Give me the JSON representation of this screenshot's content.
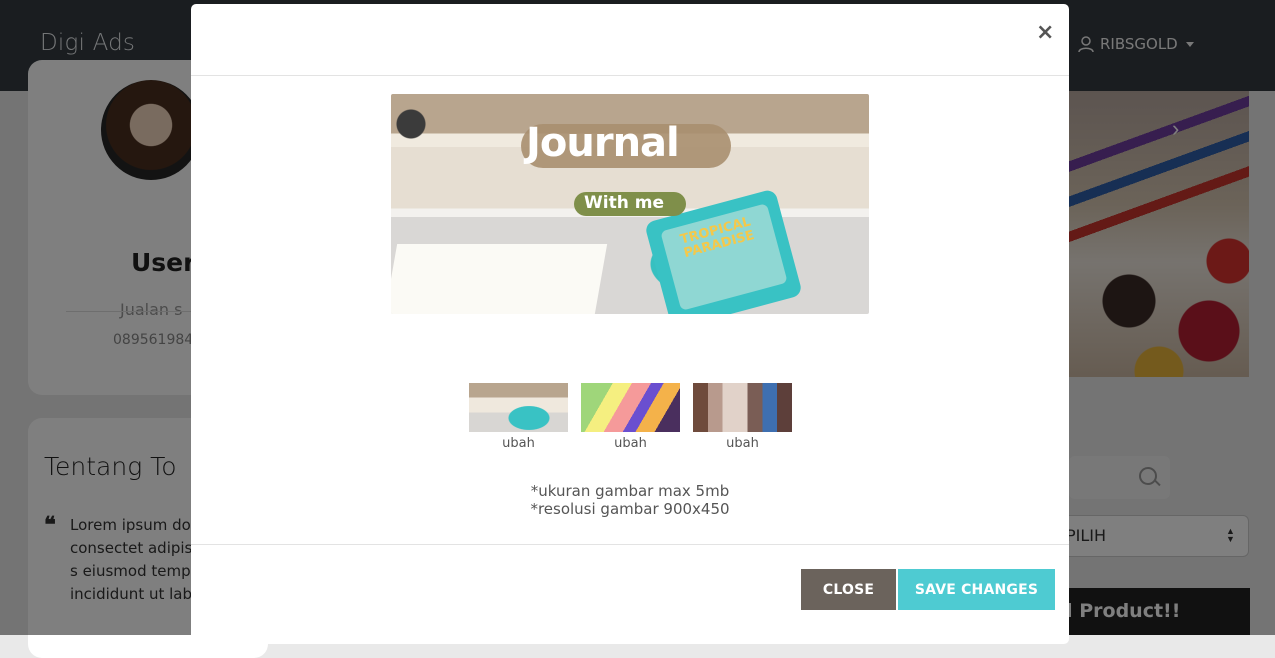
{
  "navbar": {
    "brand": "Digi Ads",
    "user_name": "RIBSGOLD"
  },
  "profile": {
    "name": "User",
    "tagline": "Jualan s",
    "phone": "089561984"
  },
  "about": {
    "title": "Tentang To",
    "text": "Lorem ipsum do amet, consectet adipiscing elit, s eiusmod tempo incididunt ut lab"
  },
  "sidebar_right": {
    "select_value": "PILIH",
    "add_product_label": "d Product!!"
  },
  "modal": {
    "close_symbol": "×",
    "main_image": {
      "title": "Journal",
      "subtitle": "With me",
      "pad_text": "TROPICAL PARADISE"
    },
    "thumbnails": [
      {
        "caption": "ubah"
      },
      {
        "caption": "ubah"
      },
      {
        "caption": "ubah"
      }
    ],
    "note_size": "*ukuran gambar max 5mb",
    "note_resolution": "*resolusi gambar 900x450",
    "close_button": "CLOSE",
    "save_button": "SAVE CHANGES"
  },
  "colors": {
    "navbar": "#343a40",
    "close_button": "#6b635c",
    "save_button": "#4ecbd2"
  },
  "icons": {
    "user": "user-icon",
    "search": "search-icon",
    "close": "close-icon"
  }
}
